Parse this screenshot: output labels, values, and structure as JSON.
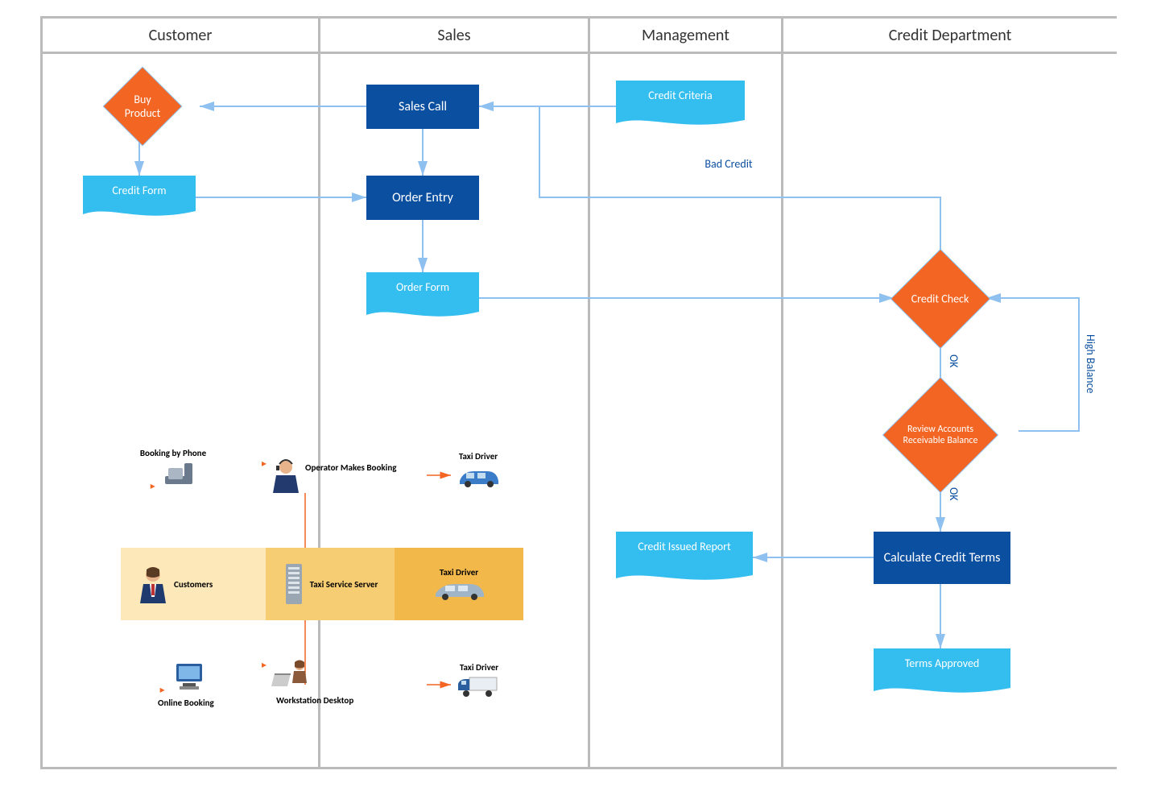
{
  "lanes": {
    "customer": "Customer",
    "sales": "Sales",
    "management": "Management",
    "credit": "Credit Department"
  },
  "nodes": {
    "buy_product": "Buy Product",
    "credit_form": "Credit Form",
    "sales_call": "Sales Call",
    "order_entry": "Order Entry",
    "order_form": "Order Form",
    "credit_criteria": "Credit Criteria",
    "credit_check": "Credit Check",
    "review_ar": "Review Accounts Receivable Balance",
    "calculate_terms": "Calculate Credit Terms",
    "credit_issued_report": "Credit Issued Report",
    "terms_approved": "Terms Approved"
  },
  "edge_labels": {
    "bad_credit": "Bad Credit",
    "ok1": "OK",
    "ok2": "OK",
    "high_balance": "High Balance"
  },
  "taxi": {
    "booking_by_phone": "Booking by Phone",
    "online_booking": "Online Booking",
    "customers": "Customers",
    "operator_makes_booking": "Operator Makes Booking",
    "workstation_desktop": "Workstation Desktop",
    "taxi_service_server": "Taxi Service Server",
    "taxi_driver": "Taxi Driver"
  }
}
